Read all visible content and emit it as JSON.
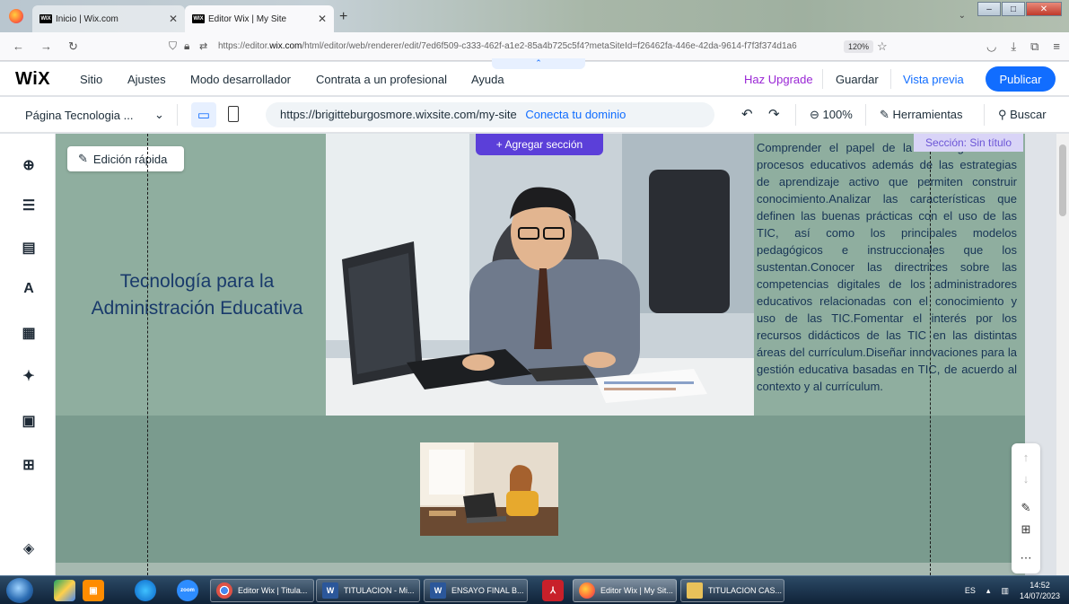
{
  "browser": {
    "tabs": [
      {
        "label": "Inicio | Wix.com",
        "active": false
      },
      {
        "label": "Editor Wix | My Site",
        "active": true
      }
    ],
    "url": "https://editor.wix.com/html/editor/web/renderer/edit/7ed6f509-c333-462f-a1e2-85a4b725c5f4?metaSiteId=f26462fa-446e-42da-9614-f7f3f374d1a6",
    "url_prefix": "https://editor.",
    "url_domain": "wix.com",
    "url_rest": "/html/editor/web/renderer/edit/7ed6f509-c333-462f-a1e2-85a4b725c5f4?metaSiteId=f26462fa-446e-42da-9614-f7f3f374d1a6",
    "zoom": "120%"
  },
  "wix_top": {
    "logo": "WiX",
    "menu": [
      "Sitio",
      "Ajustes",
      "Modo desarrollador",
      "Contrata a un profesional",
      "Ayuda"
    ],
    "upgrade": "Haz Upgrade",
    "save": "Guardar",
    "preview": "Vista previa",
    "publish": "Publicar"
  },
  "wix_secondary": {
    "page": "Página Tecnologia ...",
    "site_url": "https://brigitteburgosmore.wixsite.com/my-site",
    "connect_domain": "Conecta tu dominio",
    "zoom": "100%",
    "tools": "Herramientas",
    "search": "Buscar"
  },
  "canvas": {
    "quick_edit": "Edición rápida",
    "add_section": "+ Agregar sección",
    "section_name": "Sección: Sin título",
    "hero_title_line1": "Tecnología para la",
    "hero_title_line2": "Administración Educativa",
    "body_text": "Comprender el papel de la tecnología en los procesos educativos además de las estrategias de aprendizaje activo que permiten construir conocimiento.Analizar las características que definen las buenas prácticas con el uso de las TIC, así como los principales modelos pedagógicos e instruccionales que los sustentan.Conocer las directrices sobre las competencias digitales de los administradores educativos relacionadas con el conocimiento y uso de las TIC.Fomentar el interés por los recursos didácticos de las TIC en las distintas áreas del currículum.Diseñar innovaciones para la gestión educativa basadas en TIC, de acuerdo al contexto y al currículum."
  },
  "taskbar": {
    "items": [
      {
        "label": "Editor Wix | Titula...",
        "icon": "chrome-icon"
      },
      {
        "label": "TITULACION - Mi...",
        "icon": "word-icon"
      },
      {
        "label": "ENSAYO FINAL B...",
        "icon": "word-icon"
      },
      {
        "label": "Editor Wix | My Sit...",
        "icon": "firefox-icon"
      },
      {
        "label": "TITULACION CAS...",
        "icon": "folder-icon"
      }
    ],
    "zoom_app": "zoom",
    "language": "ES",
    "time": "14:52",
    "date": "14/07/2023"
  },
  "colors": {
    "wix_blue": "#116dff",
    "upgrade_purple": "#9a27d5",
    "add_section_purple": "#5b3fd9",
    "canvas_green": "#8fae9f",
    "canvas_dark_green": "#7a9b8e",
    "title_blue": "#193a6b"
  }
}
